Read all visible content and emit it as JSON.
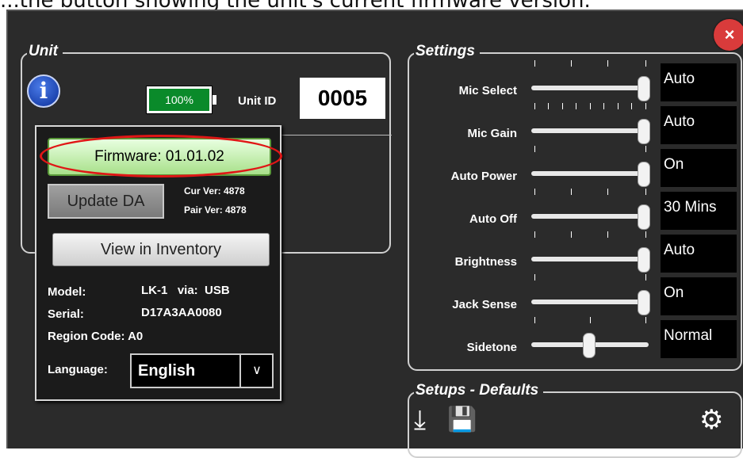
{
  "caption": "...the button showing the unit's current firmware version.",
  "window": {
    "close_icon": "×"
  },
  "unit_group": {
    "title": "Unit",
    "info_icon": "i",
    "battery_text": "100%",
    "unit_id_label": "Unit ID",
    "unit_id_value": "0005"
  },
  "popup": {
    "firmware_label": "Firmware: 01.01.02",
    "update_label": "Update DA",
    "cur_ver": "Cur Ver: 4878",
    "pair_ver": "Pair Ver: 4878",
    "view_inventory_label": "View in Inventory",
    "model_label": "Model:",
    "model_value": "LK-1   via:  USB",
    "serial_label": "Serial:",
    "serial_value": "D17A3AA0080",
    "region_label": "Region Code: A0",
    "language_label": "Language:",
    "language_value": "English",
    "language_arrow": "∨"
  },
  "settings": {
    "title": "Settings",
    "rows": [
      {
        "label": "Mic Select",
        "value": "Auto",
        "level": 1.0
      },
      {
        "label": "Mic Gain",
        "value": "Auto",
        "level": 1.0
      },
      {
        "label": "Auto Power",
        "value": "On",
        "level": 1.0
      },
      {
        "label": "Auto Off",
        "value": "30 Mins",
        "level": 1.0
      },
      {
        "label": "Brightness",
        "value": "Auto",
        "level": 1.0
      },
      {
        "label": "Jack Sense",
        "value": "On",
        "level": 1.0
      },
      {
        "label": "Sidetone",
        "value": "Normal",
        "level": 0.5
      }
    ]
  },
  "setups": {
    "title": "Setups - Defaults",
    "icons": [
      "download-icon",
      "save-icon",
      "gear-icon"
    ],
    "download_glyph": "⤓",
    "save_glyph": "💾",
    "gear_glyph": "⚙"
  }
}
